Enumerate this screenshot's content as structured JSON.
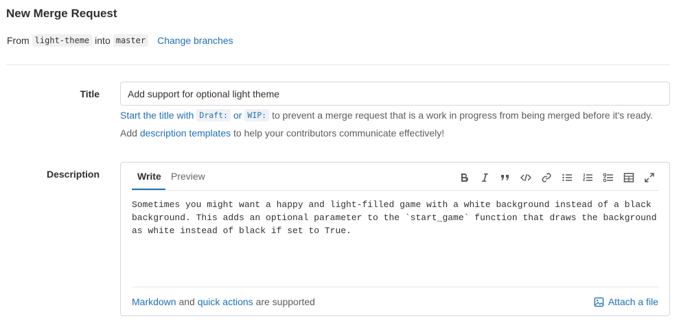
{
  "page": {
    "title": "New Merge Request"
  },
  "branches": {
    "from_label": "From",
    "source_branch": "light-theme",
    "into_label": "into",
    "target_branch": "master",
    "change_link": "Change branches"
  },
  "title_field": {
    "label": "Title",
    "value": "Add support for optional light theme"
  },
  "title_hint": {
    "prefix": "Start the title with",
    "draft_chip": "Draft:",
    "or_text": "or",
    "wip_chip": "WIP:",
    "suffix": "to prevent a merge request that is a work in progress from being merged before it's ready."
  },
  "templates_hint": {
    "prefix": "Add",
    "link": "description templates",
    "suffix": "to help your contributors communicate effectively!"
  },
  "description_field": {
    "label": "Description",
    "tabs": [
      {
        "label": "Write",
        "active": true
      },
      {
        "label": "Preview",
        "active": false
      }
    ],
    "toolbar_icons": [
      "bold-icon",
      "italic-icon",
      "quote-icon",
      "code-icon",
      "link-icon",
      "bullet-list-icon",
      "numbered-list-icon",
      "task-list-icon",
      "table-icon",
      "fullscreen-icon"
    ],
    "value": "Sometimes you might want a happy and light-filled game with a white background instead of a black\nbackground. This adds an optional parameter to the `start_game` function that draws the background\nas white instead of black if set to True."
  },
  "editor_footer": {
    "markdown_link": "Markdown",
    "and_text": "and",
    "quick_actions_link": "quick actions",
    "supported_text": "are supported",
    "attach_label": "Attach a file"
  },
  "colors": {
    "link": "#1f6fb9",
    "border": "#d6d6d6",
    "text": "#303030"
  }
}
